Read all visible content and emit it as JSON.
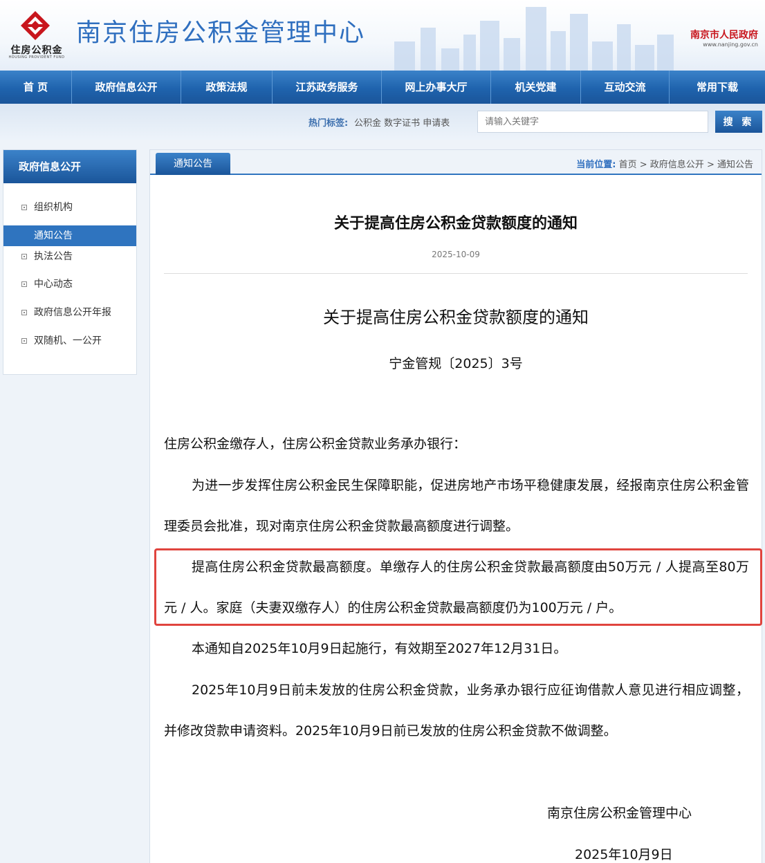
{
  "header": {
    "logo_text_cn": "住房公积金",
    "logo_text_en": "HOUSING PROVIDENT FUND",
    "site_title": "南京住房公积金管理中心",
    "gov_name": "南京市人民政府",
    "gov_url": "www.nanjing.gov.cn"
  },
  "nav": {
    "items": [
      "首 页",
      "政府信息公开",
      "政策法规",
      "江苏政务服务",
      "网上办事大厅",
      "机关党建",
      "互动交流",
      "常用下载"
    ]
  },
  "search": {
    "hot_label": "热门标签:",
    "hot_tags": "公积金  数字证书  申请表",
    "placeholder": "请输入关键字",
    "button": "搜 索"
  },
  "sidebar": {
    "title": "政府信息公开",
    "items": [
      "组织机构",
      "通知公告",
      "执法公告",
      "中心动态",
      "政府信息公开年报",
      "双随机、一公开"
    ],
    "active_index": 1
  },
  "main": {
    "tab": "通知公告",
    "breadcrumb_label": "当前位置:",
    "breadcrumb": [
      "首页",
      "政府信息公开",
      "通知公告"
    ],
    "breadcrumb_sep": ">",
    "article_title": "关于提高住房公积金贷款额度的通知",
    "article_date": "2025-10-09",
    "doc_title": "关于提高住房公积金贷款额度的通知",
    "doc_no": "宁金管规〔2025〕3号",
    "paragraphs": [
      "住房公积金缴存人，住房公积金贷款业务承办银行：",
      "为进一步发挥住房公积金民生保障职能，促进房地产市场平稳健康发展，经报南京住房公积金管理委员会批准，现对南京住房公积金贷款最高额度进行调整。",
      "提高住房公积金贷款最高额度。单缴存人的住房公积金贷款最高额度由50万元 / 人提高至80万元 / 人。家庭（夫妻双缴存人）的住房公积金贷款最高额度仍为100万元 / 户。",
      "本通知自2025年10月9日起施行，有效期至2027年12月31日。",
      "2025年10月9日前未发放的住房公积金贷款，业务承办银行应征询借款人意见进行相应调整，并修改贷款申请资料。2025年10月9日前已发放的住房公积金贷款不做调整。"
    ],
    "signature_org": "南京住房公积金管理中心",
    "signature_date": "2025年10月9日"
  },
  "colors": {
    "primary_blue": "#1f63ad",
    "title_blue": "#2f6fbf",
    "gov_red": "#c8161d",
    "highlight_red": "#e0443e"
  }
}
